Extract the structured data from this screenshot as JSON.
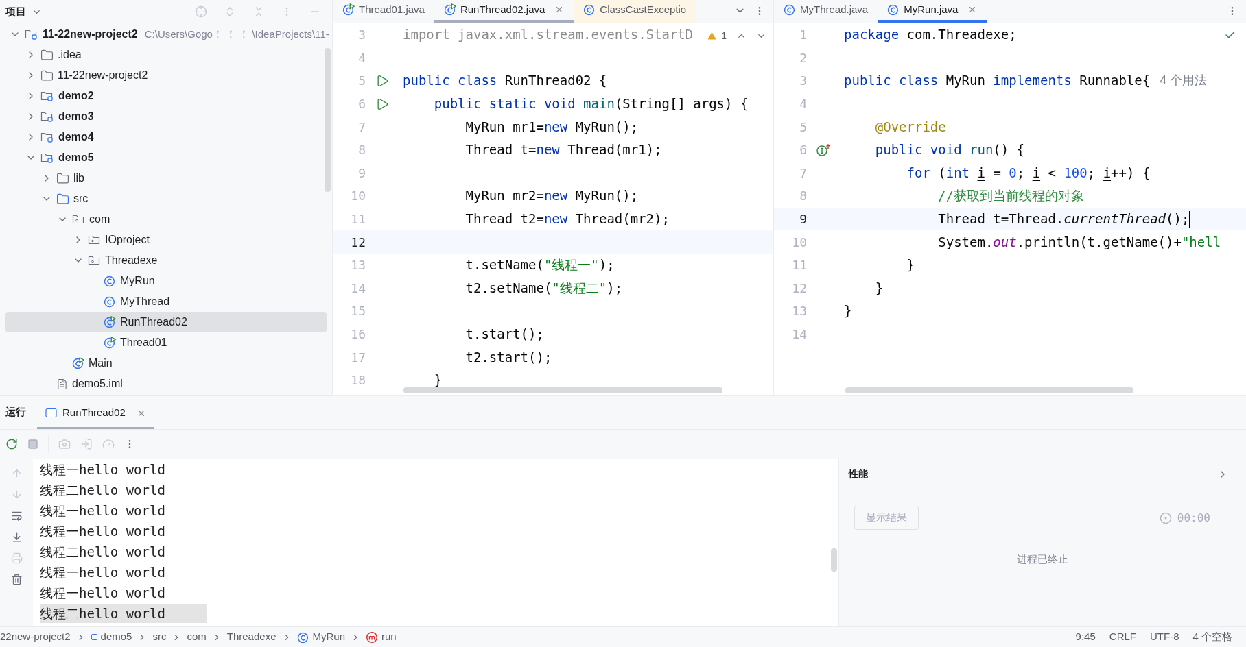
{
  "project_panel": {
    "title": "项目",
    "tree": [
      {
        "label": "11-22new-project2",
        "kind": "module",
        "path": "C:\\Users\\Gogo！ ！ ！ \\IdeaProjects\\11-",
        "expanded": true,
        "selected": false,
        "children": [
          {
            "label": ".idea",
            "kind": "folder",
            "expanded": false,
            "selected": false
          },
          {
            "label": "11-22new-project2",
            "kind": "folder",
            "expanded": false,
            "selected": false
          },
          {
            "label": "demo2",
            "kind": "module",
            "expanded": false,
            "selected": false
          },
          {
            "label": "demo3",
            "kind": "module",
            "expanded": false,
            "selected": false
          },
          {
            "label": "demo4",
            "kind": "module",
            "expanded": false,
            "selected": false
          },
          {
            "label": "demo5",
            "kind": "module",
            "expanded": true,
            "selected": false,
            "children": [
              {
                "label": "lib",
                "kind": "folder",
                "expanded": false,
                "selected": false
              },
              {
                "label": "src",
                "kind": "source",
                "expanded": true,
                "selected": false,
                "children": [
                  {
                    "label": "com",
                    "kind": "package",
                    "expanded": true,
                    "selected": false,
                    "children": [
                      {
                        "label": "IOproject",
                        "kind": "package",
                        "expanded": false,
                        "selected": false
                      },
                      {
                        "label": "Threadexe",
                        "kind": "package",
                        "expanded": true,
                        "selected": false,
                        "children": [
                          {
                            "label": "MyRun",
                            "kind": "class",
                            "selected": false
                          },
                          {
                            "label": "MyThread",
                            "kind": "class",
                            "selected": false
                          },
                          {
                            "label": "RunThread02",
                            "kind": "runnable",
                            "selected": true
                          },
                          {
                            "label": "Thread01",
                            "kind": "runnable",
                            "selected": false
                          }
                        ]
                      }
                    ]
                  },
                  {
                    "label": "Main",
                    "kind": "runnable",
                    "selected": false
                  }
                ]
              },
              {
                "label": "demo5.iml",
                "kind": "file",
                "selected": false
              }
            ]
          }
        ]
      }
    ]
  },
  "editors": [
    {
      "tabs": [
        {
          "label": "Thread01.java",
          "kind": "runnable",
          "selected": false,
          "highlighted": false
        },
        {
          "label": "RunThread02.java",
          "kind": "runnable",
          "selected": true,
          "highlighted": false
        },
        {
          "label": "ClassCastExceptio",
          "kind": "class",
          "selected": false,
          "highlighted": true
        }
      ],
      "tab_menu": true,
      "warnings": "1",
      "ok": false,
      "lines": [
        {
          "number": "3",
          "current": false,
          "tokens": [
            {
              "kind": "unused",
              "text": "import javax.xml.stream.events.StartD"
            }
          ]
        },
        {
          "number": "4",
          "current": false
        },
        {
          "number": "5",
          "current": false,
          "gutter": {
            "kind": "run"
          },
          "tokens": [
            {
              "kind": "kw",
              "text": "public class "
            },
            {
              "kind": "plain",
              "text": "RunThread02 {"
            }
          ]
        },
        {
          "number": "6",
          "current": false,
          "gutter": {
            "kind": "run"
          },
          "tokens": [
            {
              "kind": "kw",
              "text": "    public static void "
            },
            {
              "kind": "method",
              "text": "main"
            },
            {
              "kind": "plain",
              "text": "(String[] args) {"
            }
          ]
        },
        {
          "number": "7",
          "current": false,
          "tokens": [
            {
              "kind": "plain",
              "text": "        MyRun mr1="
            },
            {
              "kind": "kw",
              "text": "new"
            },
            {
              "kind": "plain",
              "text": " MyRun();"
            }
          ]
        },
        {
          "number": "8",
          "current": false,
          "tokens": [
            {
              "kind": "plain",
              "text": "        Thread t="
            },
            {
              "kind": "kw",
              "text": "new"
            },
            {
              "kind": "plain",
              "text": " Thread(mr1);"
            }
          ]
        },
        {
          "number": "9",
          "current": false
        },
        {
          "number": "10",
          "current": false,
          "tokens": [
            {
              "kind": "plain",
              "text": "        MyRun mr2="
            },
            {
              "kind": "kw",
              "text": "new"
            },
            {
              "kind": "plain",
              "text": " MyRun();"
            }
          ]
        },
        {
          "number": "11",
          "current": false,
          "tokens": [
            {
              "kind": "plain",
              "text": "        Thread t2="
            },
            {
              "kind": "kw",
              "text": "new"
            },
            {
              "kind": "plain",
              "text": " Thread(mr2);"
            }
          ]
        },
        {
          "number": "12",
          "current": true
        },
        {
          "number": "13",
          "current": false,
          "tokens": [
            {
              "kind": "plain",
              "text": "        t.setName("
            },
            {
              "kind": "str",
              "text": "\"线程一\""
            },
            {
              "kind": "plain",
              "text": ");"
            }
          ]
        },
        {
          "number": "14",
          "current": false,
          "tokens": [
            {
              "kind": "plain",
              "text": "        t2.setName("
            },
            {
              "kind": "str",
              "text": "\"线程二\""
            },
            {
              "kind": "plain",
              "text": ");"
            }
          ]
        },
        {
          "number": "15",
          "current": false
        },
        {
          "number": "16",
          "current": false,
          "tokens": [
            {
              "kind": "plain",
              "text": "        t.start();"
            }
          ]
        },
        {
          "number": "17",
          "current": false,
          "tokens": [
            {
              "kind": "plain",
              "text": "        t2.start();"
            }
          ]
        },
        {
          "number": "18",
          "current": false,
          "tokens": [
            {
              "kind": "plain",
              "text": "    }"
            }
          ]
        }
      ]
    },
    {
      "tabs": [
        {
          "label": "MyThread.java",
          "kind": "class",
          "selected": false,
          "highlighted": false
        },
        {
          "label": "MyRun.java",
          "kind": "class",
          "selected": true,
          "highlighted": false
        }
      ],
      "tab_menu": false,
      "ok": true,
      "lines": [
        {
          "number": "1",
          "current": false,
          "tokens": [
            {
              "kind": "kw",
              "text": "package"
            },
            {
              "kind": "plain",
              "text": " com.Threadexe;"
            }
          ]
        },
        {
          "number": "2",
          "current": false
        },
        {
          "number": "3",
          "current": false,
          "hint": "4 个用法",
          "tokens": [
            {
              "kind": "kw",
              "text": "public class "
            },
            {
              "kind": "plain",
              "text": "MyRun "
            },
            {
              "kind": "kw",
              "text": "implements "
            },
            {
              "kind": "plain",
              "text": "Runnable{"
            }
          ]
        },
        {
          "number": "4",
          "current": false
        },
        {
          "number": "5",
          "current": false,
          "tokens": [
            {
              "kind": "annot",
              "text": "    @Override"
            }
          ]
        },
        {
          "number": "6",
          "current": false,
          "gutter": {
            "kind": "implements"
          },
          "tokens": [
            {
              "kind": "kw",
              "text": "    public void "
            },
            {
              "kind": "method",
              "text": "run"
            },
            {
              "kind": "plain",
              "text": "() {"
            }
          ]
        },
        {
          "number": "7",
          "current": false,
          "tokens": [
            {
              "kind": "kw",
              "text": "        for "
            },
            {
              "kind": "plain",
              "text": "("
            },
            {
              "kind": "kw",
              "text": "int "
            },
            {
              "kind": "var",
              "text": "i"
            },
            {
              "kind": "plain",
              "text": " = "
            },
            {
              "kind": "num",
              "text": "0"
            },
            {
              "kind": "plain",
              "text": "; "
            },
            {
              "kind": "var",
              "text": "i"
            },
            {
              "kind": "plain",
              "text": " < "
            },
            {
              "kind": "num",
              "text": "100"
            },
            {
              "kind": "plain",
              "text": "; "
            },
            {
              "kind": "var",
              "text": "i"
            },
            {
              "kind": "plain",
              "text": "++) {"
            }
          ]
        },
        {
          "number": "8",
          "current": false,
          "tokens": [
            {
              "kind": "comment",
              "text": "            //获取到当前线程的对象"
            }
          ]
        },
        {
          "number": "9",
          "current": true,
          "caret": true,
          "tokens": [
            {
              "kind": "plain",
              "text": "            Thread t=Thread."
            },
            {
              "kind": "italic",
              "text": "currentThread"
            },
            {
              "kind": "plain",
              "text": "();"
            }
          ]
        },
        {
          "number": "10",
          "current": false,
          "tokens": [
            {
              "kind": "plain",
              "text": "            System."
            },
            {
              "kind": "field",
              "text": "out"
            },
            {
              "kind": "plain",
              "text": ".println(t.getName()+"
            },
            {
              "kind": "str",
              "text": "\"hell"
            }
          ]
        },
        {
          "number": "11",
          "current": false,
          "tokens": [
            {
              "kind": "plain",
              "text": "        }"
            }
          ]
        },
        {
          "number": "12",
          "current": false,
          "tokens": [
            {
              "kind": "plain",
              "text": "    }"
            }
          ]
        },
        {
          "number": "13",
          "current": false,
          "tokens": [
            {
              "kind": "plain",
              "text": "}"
            }
          ]
        },
        {
          "number": "14",
          "current": false
        }
      ]
    }
  ],
  "run_panel": {
    "title": "运行",
    "tabs": [
      {
        "label": "RunThread02",
        "selected": true
      }
    ],
    "console": [
      {
        "text": "线程一hello world",
        "selected": false
      },
      {
        "text": "线程二hello world",
        "selected": false
      },
      {
        "text": "线程一hello world",
        "selected": false
      },
      {
        "text": "线程一hello world",
        "selected": false
      },
      {
        "text": "线程二hello world",
        "selected": false
      },
      {
        "text": "线程一hello world",
        "selected": false
      },
      {
        "text": "线程一hello world",
        "selected": false
      },
      {
        "text": "线程二hello world",
        "selected": true
      }
    ],
    "performance": {
      "title": "性能",
      "button": "显示结果",
      "timer": "00:00",
      "status": "进程已终止"
    }
  },
  "status_bar": {
    "breadcrumbs": [
      {
        "label": "22new-project2",
        "kind": "plain"
      },
      {
        "label": "demo5",
        "kind": "module"
      },
      {
        "label": "src",
        "kind": "plain"
      },
      {
        "label": "com",
        "kind": "plain"
      },
      {
        "label": "Threadexe",
        "kind": "plain"
      },
      {
        "label": "MyRun",
        "kind": "class"
      },
      {
        "label": "run",
        "kind": "method"
      }
    ],
    "items": [
      "9:45",
      "CRLF",
      "UTF-8",
      "4 个空格"
    ]
  }
}
